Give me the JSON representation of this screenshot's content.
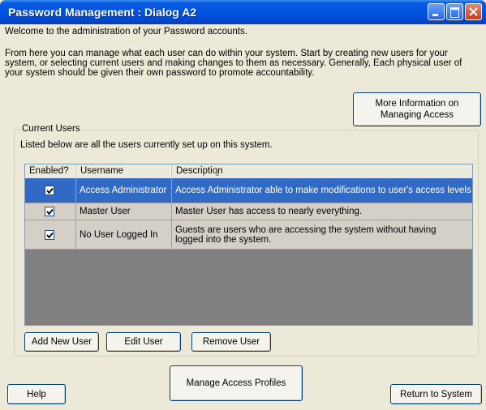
{
  "window": {
    "title": "Password Management : Dialog A2"
  },
  "welcome_text": "Welcome to the administration of your Password accounts.",
  "intro_text": "From here you can manage what each user can do within your system. Start by creating new users for your system, or selecting current users and making changes to them as necessary. Generally, Each physical user of your system should be given their own password to promote accountability.",
  "more_info_button": "More Information on Managing Access",
  "current_users": {
    "group_label": "Current Users",
    "description": "Listed below are all the users currently set up on this system.",
    "columns": [
      "Enabled?",
      "Username",
      "Description"
    ],
    "rows": [
      {
        "enabled": true,
        "username": "Access Administrator",
        "description": "Access Administrator able to make modifications to user's access levels",
        "selected": true
      },
      {
        "enabled": true,
        "username": "Master User",
        "description": "Master User has access to nearly everything.",
        "selected": false
      },
      {
        "enabled": true,
        "username": "No User Logged In",
        "description": "Guests are users who are accessing the system without having logged into the system.",
        "selected": false
      }
    ],
    "buttons": {
      "add": "Add New User",
      "edit": "Edit User",
      "remove": "Remove User"
    }
  },
  "footer": {
    "help": "Help",
    "manage_profiles": "Manage Access Profiles",
    "return": "Return to System"
  },
  "colors": {
    "titlebar": "#0053e0",
    "selection": "#316ac5",
    "dialog_bg": "#ece9d8"
  }
}
